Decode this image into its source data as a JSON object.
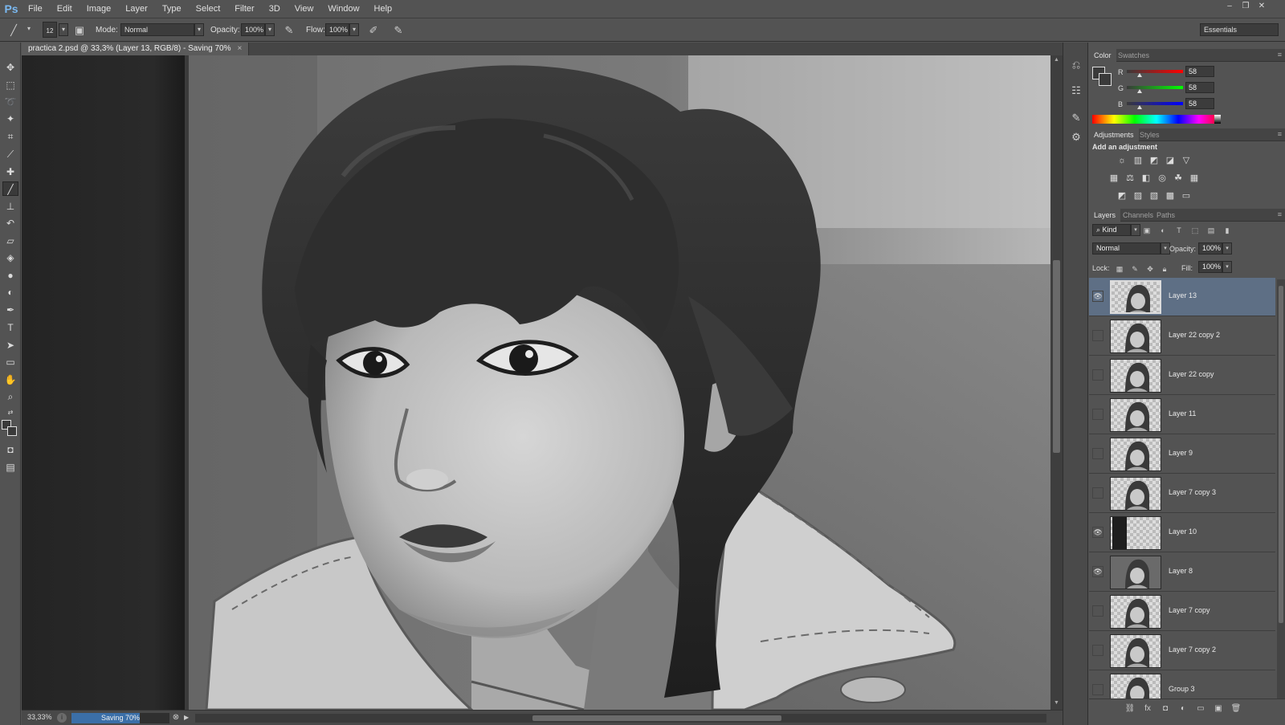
{
  "app": {
    "logo": "Ps"
  },
  "menu": [
    "File",
    "Edit",
    "Image",
    "Layer",
    "Type",
    "Select",
    "Filter",
    "3D",
    "View",
    "Window",
    "Help"
  ],
  "window_controls": {
    "minimize": "–",
    "restore": "❐",
    "close": "✕"
  },
  "options": {
    "brush_size": "12",
    "mode_label": "Mode:",
    "mode_value": "Normal",
    "opacity_label": "Opacity:",
    "opacity_value": "100%",
    "flow_label": "Flow:",
    "flow_value": "100%",
    "workspace": "Essentials"
  },
  "document": {
    "tab_title": "practica 2.psd @ 33,3% (Layer 13, RGB/8) - Saving 70%",
    "close": "×"
  },
  "status": {
    "zoom": "33,33%",
    "progress_text": "Saving 70%",
    "progress": 0.7
  },
  "color_panel": {
    "tabs": [
      "Color",
      "Swatches"
    ],
    "r_label": "R",
    "r_value": "58",
    "g_label": "G",
    "g_value": "58",
    "b_label": "B",
    "b_value": "58",
    "value_fraction": 0.227
  },
  "adjustments_panel": {
    "tabs": [
      "Adjustments",
      "Styles"
    ],
    "title": "Add an adjustment"
  },
  "layers_panel": {
    "tabs": [
      "Layers",
      "Channels",
      "Paths"
    ],
    "filter_value": "Kind",
    "blend_mode": "Normal",
    "opacity_label": "Opacity:",
    "opacity_value": "100%",
    "lock_label": "Lock:",
    "fill_label": "Fill:",
    "fill_value": "100%",
    "layers": [
      {
        "name": "Layer 13",
        "visible": true,
        "selected": true
      },
      {
        "name": "Layer 22 copy 2",
        "visible": false,
        "selected": false
      },
      {
        "name": "Layer 22 copy",
        "visible": false,
        "selected": false
      },
      {
        "name": "Layer 11",
        "visible": false,
        "selected": false
      },
      {
        "name": "Layer 9",
        "visible": false,
        "selected": false
      },
      {
        "name": "Layer 7 copy 3",
        "visible": false,
        "selected": false
      },
      {
        "name": "Layer 10",
        "visible": true,
        "selected": false
      },
      {
        "name": "Layer 8",
        "visible": true,
        "selected": false
      },
      {
        "name": "Layer 7 copy",
        "visible": false,
        "selected": false
      },
      {
        "name": "Layer 7 copy 2",
        "visible": false,
        "selected": false
      },
      {
        "name": "Group 3",
        "visible": false,
        "selected": false
      }
    ]
  },
  "colors": {
    "ui_bg": "#535353",
    "selection": "#5e6f85",
    "progress": "#3b6fa8",
    "ps_blue": "#7ab8f0"
  }
}
